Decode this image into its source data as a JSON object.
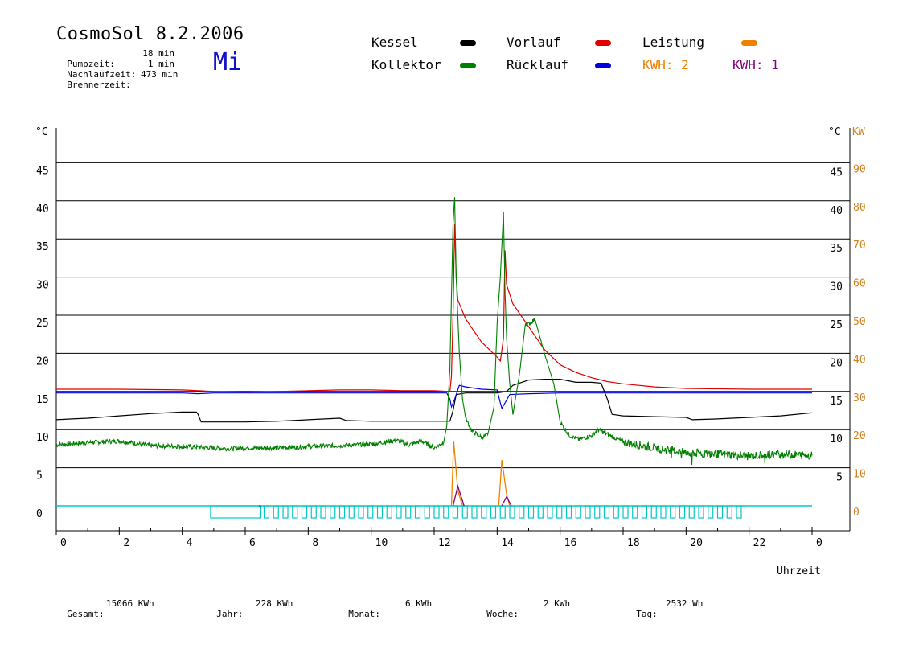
{
  "header": {
    "title": "CosmoSol 8.2.2006",
    "weekday": "Mi",
    "stats": [
      {
        "label": "Pumpzeit:",
        "value": "18 min"
      },
      {
        "label": "Nachlaufzeit:",
        "value": "1 min"
      },
      {
        "label": "Brennerzeit:",
        "value": "473 min"
      }
    ]
  },
  "legend": {
    "kessel": {
      "label": "Kessel",
      "color": "#000000"
    },
    "vorlauf": {
      "label": "Vorlauf",
      "color": "#e00000"
    },
    "leistung": {
      "label": "Leistung",
      "color": "#f08000"
    },
    "kollektor": {
      "label": "Kollektor",
      "color": "#008000"
    },
    "ruecklauf": {
      "label": "Rücklauf",
      "color": "#0000e0"
    },
    "kwh1": {
      "label": "KWH: 2",
      "color": "#f08000"
    },
    "kwh2": {
      "label": "KWH: 1",
      "color": "#800080"
    }
  },
  "footer": [
    {
      "label": "Gesamt:",
      "value": "15066 KWh"
    },
    {
      "label": "Jahr:",
      "value": "228 KWh"
    },
    {
      "label": "Monat:",
      "value": "6 KWh"
    },
    {
      "label": "Woche:",
      "value": "2 KWh"
    },
    {
      "label": "Tag:",
      "value": "2532 Wh"
    }
  ],
  "chart_data": {
    "type": "line",
    "title": "",
    "xlabel": "Uhrzeit",
    "ylabel_left": "°C",
    "ylabel_right_temp": "°C",
    "ylabel_right_power": "KW",
    "xlim": [
      0,
      24
    ],
    "ylim": [
      0,
      50
    ],
    "power_ylim": [
      0,
      100
    ],
    "x_tick_labels": [
      "0",
      "2",
      "4",
      "6",
      "8",
      "10",
      "12",
      "14",
      "16",
      "18",
      "20",
      "22",
      "0"
    ],
    "y_tick_labels": [
      "0",
      "5",
      "10",
      "15",
      "20",
      "25",
      "30",
      "35",
      "40",
      "45"
    ],
    "power_tick_labels": [
      "0",
      "10",
      "20",
      "30",
      "40",
      "50",
      "60",
      "70",
      "80",
      "90"
    ],
    "grid": "horizontal",
    "colors": {
      "kessel": "#000000",
      "vorlauf": "#e00000",
      "kollektor": "#008000",
      "ruecklauf": "#0000e0",
      "leistung": "#f08000",
      "kwh2": "#800080",
      "pump": "#00c8c8"
    },
    "series": [
      {
        "key": "kessel",
        "name": "Kessel",
        "points": [
          [
            0,
            11.3
          ],
          [
            0.5,
            11.4
          ],
          [
            1,
            11.5
          ],
          [
            2,
            11.8
          ],
          [
            3,
            12.1
          ],
          [
            4,
            12.3
          ],
          [
            4.45,
            12.3
          ],
          [
            4.5,
            12.0
          ],
          [
            4.6,
            11.0
          ],
          [
            5,
            11.0
          ],
          [
            6,
            11.0
          ],
          [
            7,
            11.1
          ],
          [
            8,
            11.3
          ],
          [
            9,
            11.5
          ],
          [
            9.2,
            11.2
          ],
          [
            10,
            11.1
          ],
          [
            11,
            11.1
          ],
          [
            12,
            11.1
          ],
          [
            12.5,
            11.1
          ],
          [
            12.6,
            12.5
          ],
          [
            12.7,
            14.6
          ],
          [
            13,
            14.8
          ],
          [
            14,
            14.8
          ],
          [
            14.3,
            15.0
          ],
          [
            14.5,
            15.8
          ],
          [
            15,
            16.5
          ],
          [
            15.5,
            16.6
          ],
          [
            16,
            16.6
          ],
          [
            16.5,
            16.2
          ],
          [
            17,
            16.2
          ],
          [
            17.3,
            16.1
          ],
          [
            17.5,
            14.0
          ],
          [
            17.65,
            12.0
          ],
          [
            18,
            11.8
          ],
          [
            19,
            11.7
          ],
          [
            20,
            11.6
          ],
          [
            20.2,
            11.3
          ],
          [
            21,
            11.4
          ],
          [
            22,
            11.6
          ],
          [
            23,
            11.8
          ],
          [
            24,
            12.2
          ]
        ]
      },
      {
        "key": "vorlauf",
        "name": "Vorlauf",
        "points": [
          [
            0,
            15.3
          ],
          [
            2,
            15.3
          ],
          [
            4,
            15.2
          ],
          [
            5,
            15.0
          ],
          [
            6,
            14.9
          ],
          [
            7,
            15.0
          ],
          [
            8,
            15.1
          ],
          [
            9,
            15.2
          ],
          [
            10,
            15.2
          ],
          [
            11,
            15.1
          ],
          [
            12,
            15.1
          ],
          [
            12.5,
            15.0
          ],
          [
            12.55,
            17.0
          ],
          [
            12.6,
            25.0
          ],
          [
            12.65,
            37.0
          ],
          [
            12.7,
            30.0
          ],
          [
            12.75,
            27.0
          ],
          [
            13,
            24.5
          ],
          [
            13.5,
            21.5
          ],
          [
            14,
            19.5
          ],
          [
            14.1,
            19.0
          ],
          [
            14.2,
            22.0
          ],
          [
            14.25,
            33.5
          ],
          [
            14.3,
            29.0
          ],
          [
            14.5,
            26.5
          ],
          [
            15,
            23.5
          ],
          [
            15.5,
            20.5
          ],
          [
            16,
            18.5
          ],
          [
            16.5,
            17.5
          ],
          [
            17,
            16.8
          ],
          [
            17.5,
            16.3
          ],
          [
            18,
            16.0
          ],
          [
            19,
            15.6
          ],
          [
            20,
            15.4
          ],
          [
            22,
            15.3
          ],
          [
            24,
            15.3
          ]
        ]
      },
      {
        "key": "ruecklauf",
        "name": "Rücklauf",
        "points": [
          [
            0,
            14.8
          ],
          [
            2,
            14.8
          ],
          [
            4,
            14.8
          ],
          [
            4.5,
            14.7
          ],
          [
            5,
            14.8
          ],
          [
            7,
            14.8
          ],
          [
            10,
            14.8
          ],
          [
            12,
            14.8
          ],
          [
            12.4,
            14.8
          ],
          [
            12.5,
            14.0
          ],
          [
            12.55,
            13.0
          ],
          [
            12.65,
            14.0
          ],
          [
            12.8,
            15.8
          ],
          [
            13,
            15.6
          ],
          [
            13.5,
            15.3
          ],
          [
            14,
            15.2
          ],
          [
            14.1,
            13.5
          ],
          [
            14.15,
            12.8
          ],
          [
            14.25,
            13.5
          ],
          [
            14.4,
            14.6
          ],
          [
            15,
            14.7
          ],
          [
            16,
            14.8
          ],
          [
            18,
            14.8
          ],
          [
            20,
            14.8
          ],
          [
            22,
            14.8
          ],
          [
            24,
            14.8
          ]
        ]
      },
      {
        "key": "kollektor",
        "name": "Kollektor",
        "noisy": true,
        "points": [
          [
            0,
            8.0
          ],
          [
            1,
            8.3
          ],
          [
            2,
            8.5
          ],
          [
            3,
            7.9
          ],
          [
            4,
            7.8
          ],
          [
            5,
            7.6
          ],
          [
            5.5,
            7.5
          ],
          [
            6,
            7.6
          ],
          [
            7,
            7.6
          ],
          [
            8,
            7.8
          ],
          [
            9,
            7.9
          ],
          [
            10,
            8.1
          ],
          [
            10.8,
            8.6
          ],
          [
            11.2,
            8.0
          ],
          [
            11.6,
            8.5
          ],
          [
            12,
            7.6
          ],
          [
            12.3,
            8.3
          ],
          [
            12.4,
            10.5
          ],
          [
            12.5,
            18.0
          ],
          [
            12.6,
            37.0
          ],
          [
            12.65,
            40.5
          ],
          [
            12.7,
            30.0
          ],
          [
            12.8,
            20.0
          ],
          [
            12.9,
            14.0
          ],
          [
            13.0,
            11.5
          ],
          [
            13.2,
            9.8
          ],
          [
            13.5,
            9.0
          ],
          [
            13.7,
            9.3
          ],
          [
            13.9,
            13.0
          ],
          [
            14.0,
            24.0
          ],
          [
            14.1,
            30.0
          ],
          [
            14.2,
            38.5
          ],
          [
            14.25,
            28.0
          ],
          [
            14.3,
            22.0
          ],
          [
            14.4,
            16.0
          ],
          [
            14.5,
            12.0
          ],
          [
            14.7,
            17.0
          ],
          [
            14.9,
            24.0
          ],
          [
            15,
            23.8
          ],
          [
            15.2,
            24.5
          ],
          [
            15.5,
            20.0
          ],
          [
            15.8,
            16.0
          ],
          [
            16,
            11.0
          ],
          [
            16.3,
            9.2
          ],
          [
            16.6,
            8.7
          ],
          [
            17,
            9.2
          ],
          [
            17.2,
            10.0
          ],
          [
            17.6,
            9.2
          ],
          [
            18,
            8.4
          ],
          [
            19,
            7.6
          ],
          [
            20,
            7.0
          ],
          [
            21,
            6.8
          ],
          [
            22,
            6.5
          ],
          [
            23,
            6.8
          ],
          [
            24,
            6.6
          ]
        ]
      }
    ],
    "leistung_peaks": [
      [
        12.55,
        0
      ],
      [
        12.62,
        8.5
      ],
      [
        12.75,
        2.0
      ],
      [
        12.9,
        0
      ],
      [
        14.05,
        0
      ],
      [
        14.15,
        6.0
      ],
      [
        14.3,
        1.5
      ],
      [
        14.4,
        0
      ]
    ],
    "kwh2_peaks": [
      [
        12.6,
        0
      ],
      [
        12.75,
        2.6
      ],
      [
        12.95,
        0
      ],
      [
        14.15,
        0
      ],
      [
        14.3,
        1.2
      ],
      [
        14.45,
        0
      ]
    ],
    "pump_state": [
      [
        4.9,
        6.5
      ],
      [
        6.6,
        21.8
      ]
    ]
  }
}
